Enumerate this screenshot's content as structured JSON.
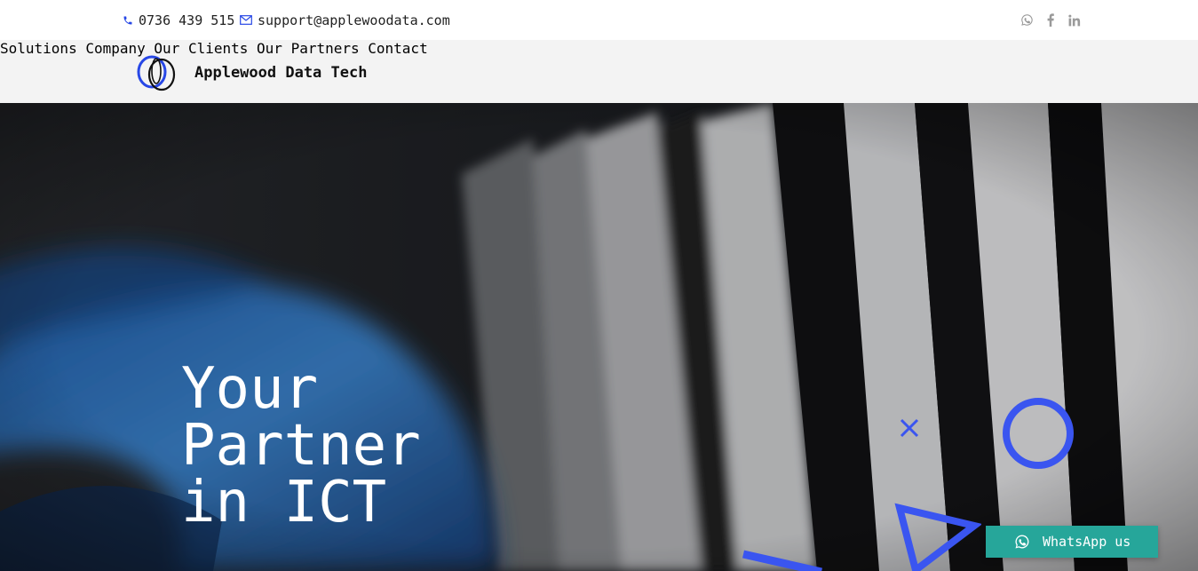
{
  "topbar": {
    "phone": "0736 439 515",
    "email": "support@applewoodata.com",
    "social": [
      "whatsapp-icon",
      "facebook-icon",
      "linkedin-icon"
    ]
  },
  "brand": {
    "name": "Applewood Data Tech"
  },
  "nav": {
    "items": [
      {
        "label": "Solutions"
      },
      {
        "label": "Company"
      },
      {
        "label": "Our Clients"
      },
      {
        "label": "Our Partners"
      },
      {
        "label": "Contact"
      }
    ]
  },
  "hero": {
    "lines": [
      "Your",
      "Partner",
      "in ICT"
    ]
  },
  "whatsapp": {
    "label": "WhatsApp us"
  },
  "colors": {
    "accent": "#3a55f0",
    "whatsapp": "#26a69a",
    "nav_bg": "#f3f3f3"
  }
}
